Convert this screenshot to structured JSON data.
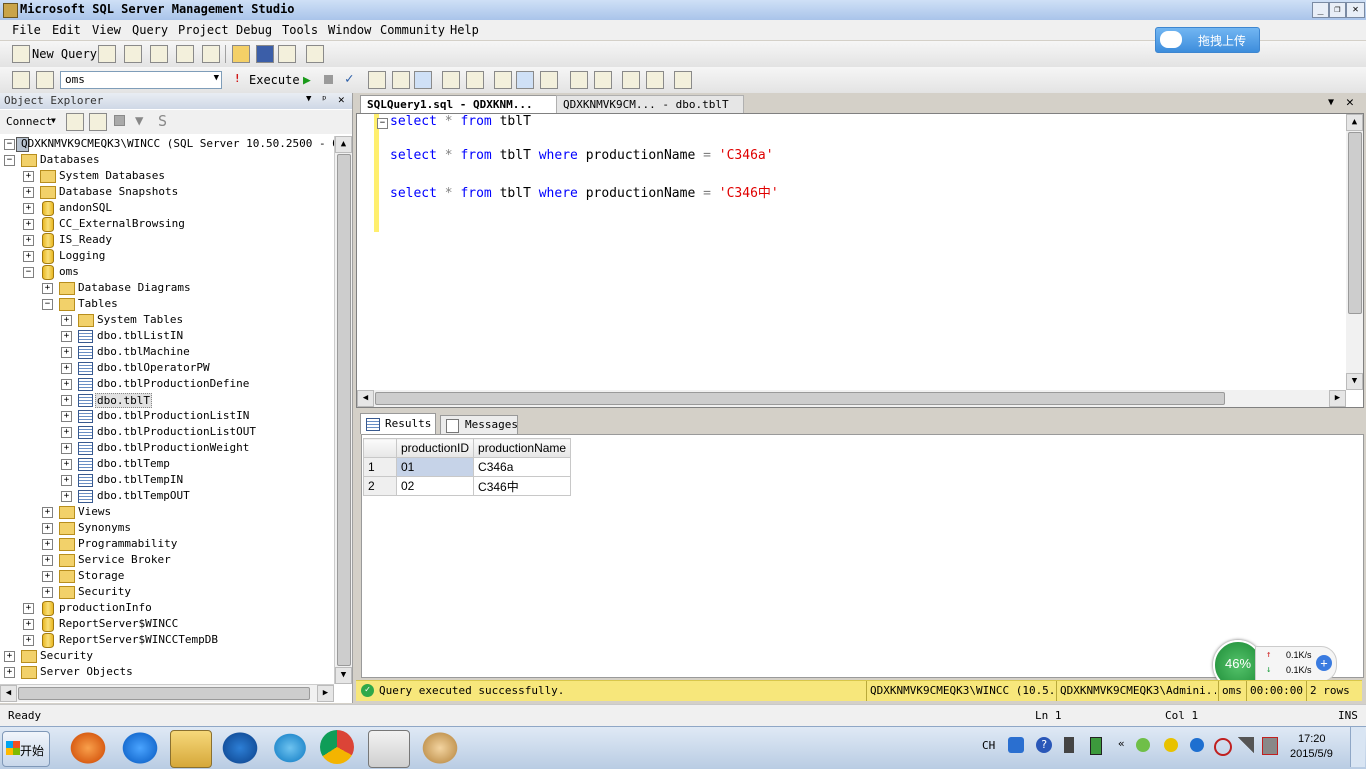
{
  "window": {
    "title": "Microsoft SQL Server Management Studio"
  },
  "menu": [
    "File",
    "Edit",
    "View",
    "Query",
    "Project",
    "Debug",
    "Tools",
    "Window",
    "Community",
    "Help"
  ],
  "toolbar": {
    "new_query": "New Query",
    "database": "oms",
    "execute": "Execute"
  },
  "upload_button": {
    "label": "拖拽上传"
  },
  "object_explorer": {
    "title": "Object Explorer",
    "connect": "Connect",
    "server": "QDXKNMVK9CMEQK3\\WINCC (SQL Server 10.50.2500 - QDXKN",
    "databases_label": "Databases",
    "system_dbs": "System Databases",
    "snapshots": "Database Snapshots",
    "db_andon": "andonSQL",
    "db_cc": "CC_ExternalBrowsing",
    "db_is": "IS_Ready",
    "db_logging": "Logging",
    "db_oms": "oms",
    "diagrams": "Database Diagrams",
    "tables": "Tables",
    "system_tables": "System Tables",
    "t1": "dbo.tblListIN",
    "t2": "dbo.tblMachine",
    "t3": "dbo.tblOperatorPW",
    "t4": "dbo.tblProductionDefine",
    "t5": "dbo.tblT",
    "t6": "dbo.tblProductionListIN",
    "t7": "dbo.tblProductionListOUT",
    "t8": "dbo.tblProductionWeight",
    "t9": "dbo.tblTemp",
    "t10": "dbo.tblTempIN",
    "t11": "dbo.tblTempOUT",
    "views": "Views",
    "synonyms": "Synonyms",
    "programmability": "Programmability",
    "service_broker": "Service Broker",
    "storage": "Storage",
    "security_db": "Security",
    "db_prodinfo": "productionInfo",
    "db_rs": "ReportServer$WINCC",
    "db_rstemp": "ReportServer$WINCCTempDB",
    "security": "Security",
    "server_objects": "Server Objects"
  },
  "tabs": {
    "active": "SQLQuery1.sql - QDXKNM...",
    "other": "QDXKNMVK9CM... - dbo.tblT"
  },
  "editor": {
    "kw_select": "select",
    "star": "*",
    "kw_from": "from",
    "table": "tblT",
    "kw_where": "where",
    "column": "productionName",
    "eq": "=",
    "value1": "'C346a'",
    "value2": "'C346中'"
  },
  "results_tabs": {
    "results": "Results",
    "messages": "Messages"
  },
  "grid": {
    "columns": [
      "productionID",
      "productionName"
    ],
    "rows": [
      {
        "n": "1",
        "id": "01",
        "name": "C346a"
      },
      {
        "n": "2",
        "id": "02",
        "name": "C346中"
      }
    ]
  },
  "query_status": {
    "message": "Query executed successfully.",
    "server": "QDXKNMVK9CMEQK3\\WINCC (10.5...",
    "user": "QDXKNMVK9CMEQK3\\Admini...",
    "db": "oms",
    "time": "00:00:00",
    "rows": "2 rows"
  },
  "statusbar": {
    "ready": "Ready",
    "ln": "Ln 1",
    "col": "Col 1",
    "ins": "INS"
  },
  "network_widget": {
    "percent": "46%",
    "up": "0.1K/s",
    "down": "0.1K/s"
  },
  "taskbar": {
    "start": "开始",
    "lang": "CH",
    "time": "17:20",
    "date": "2015/5/9"
  }
}
